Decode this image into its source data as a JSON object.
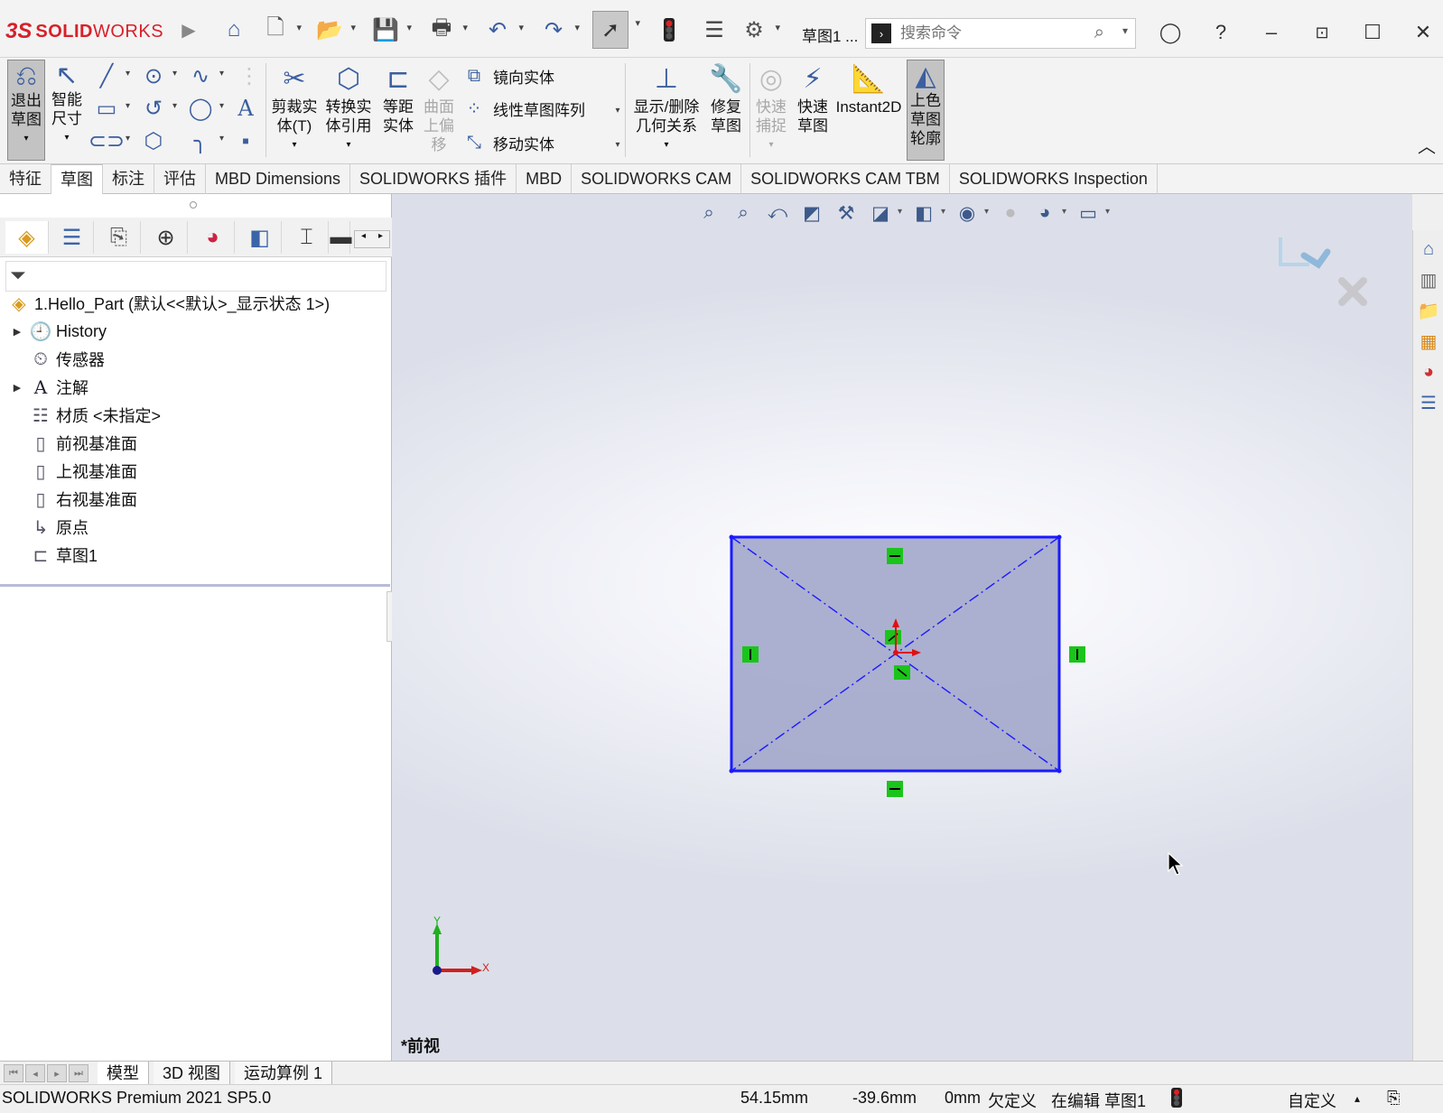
{
  "titlebar": {
    "app_brand_ds": "3S",
    "app_brand_solid": "SOLID",
    "app_brand_works": "WORKS",
    "doc_title": "草图1 ...",
    "search_placeholder": "搜索命令"
  },
  "command_manager": {
    "exit_sketch": "退出\n草图",
    "exit_line1": "退出",
    "exit_line2": "草图",
    "smart_dim_line1": "智能",
    "smart_dim_line2": "尺寸",
    "trim_line1": "剪裁实",
    "trim_line2": "体(T)",
    "convert_line1": "转换实",
    "convert_line2": "体引用",
    "offset_line1": "等距",
    "offset_line2": "实体",
    "surface_offset_line1": "曲面",
    "surface_offset_line2": "上偏",
    "surface_offset_line3": "移",
    "mirror": "镜向实体",
    "linear_pattern": "线性草图阵列",
    "move": "移动实体",
    "relations_line1": "显示/删除",
    "relations_line2": "几何关系",
    "repair_line1": "修复",
    "repair_line2": "草图",
    "quick_snap_line1": "快速",
    "quick_snap_line2": "捕捉",
    "rapid_line1": "快速",
    "rapid_line2": "草图",
    "instant2d": "Instant2D",
    "shaded_line1": "上色",
    "shaded_line2": "草图",
    "shaded_line3": "轮廓"
  },
  "tabs": [
    {
      "label": "特征"
    },
    {
      "label": "草图"
    },
    {
      "label": "标注"
    },
    {
      "label": "评估"
    },
    {
      "label": "MBD Dimensions"
    },
    {
      "label": "SOLIDWORKS 插件"
    },
    {
      "label": "MBD"
    },
    {
      "label": "SOLIDWORKS CAM"
    },
    {
      "label": "SOLIDWORKS CAM TBM"
    },
    {
      "label": "SOLIDWORKS Inspection"
    }
  ],
  "tree": {
    "root": "1.Hello_Part  (默认<<默认>_显示状态 1>)",
    "items": [
      {
        "label": "History",
        "icon": "history-icon"
      },
      {
        "label": "传感器",
        "icon": "sensor-icon"
      },
      {
        "label": "注解",
        "icon": "annotation-icon"
      },
      {
        "label": "材质 <未指定>",
        "icon": "material-icon"
      },
      {
        "label": "前视基准面",
        "icon": "plane-icon"
      },
      {
        "label": "上视基准面",
        "icon": "plane-icon"
      },
      {
        "label": "右视基准面",
        "icon": "plane-icon"
      },
      {
        "label": "原点",
        "icon": "origin-icon"
      },
      {
        "label": "草图1",
        "icon": "sketch-icon"
      }
    ]
  },
  "viewport": {
    "view_name": "*前视",
    "triad_x": "X",
    "triad_y": "Y"
  },
  "bottom_tabs": [
    {
      "label": "模型"
    },
    {
      "label": "3D 视图"
    },
    {
      "label": "运动算例 1"
    }
  ],
  "status": {
    "product": "SOLIDWORKS Premium 2021 SP5.0",
    "x_coord": "54.15mm",
    "y_coord": "-39.6mm",
    "z_coord": "0mm",
    "define_state": "欠定义",
    "editing": "在编辑 草图1",
    "units": "自定义"
  },
  "colors": {
    "brand_red": "#d8202a",
    "sketch_blue": "#1a1aff",
    "sketch_fill": "#9fa3c8",
    "relation_green": "#1bc41b",
    "origin_red": "#e01010"
  }
}
